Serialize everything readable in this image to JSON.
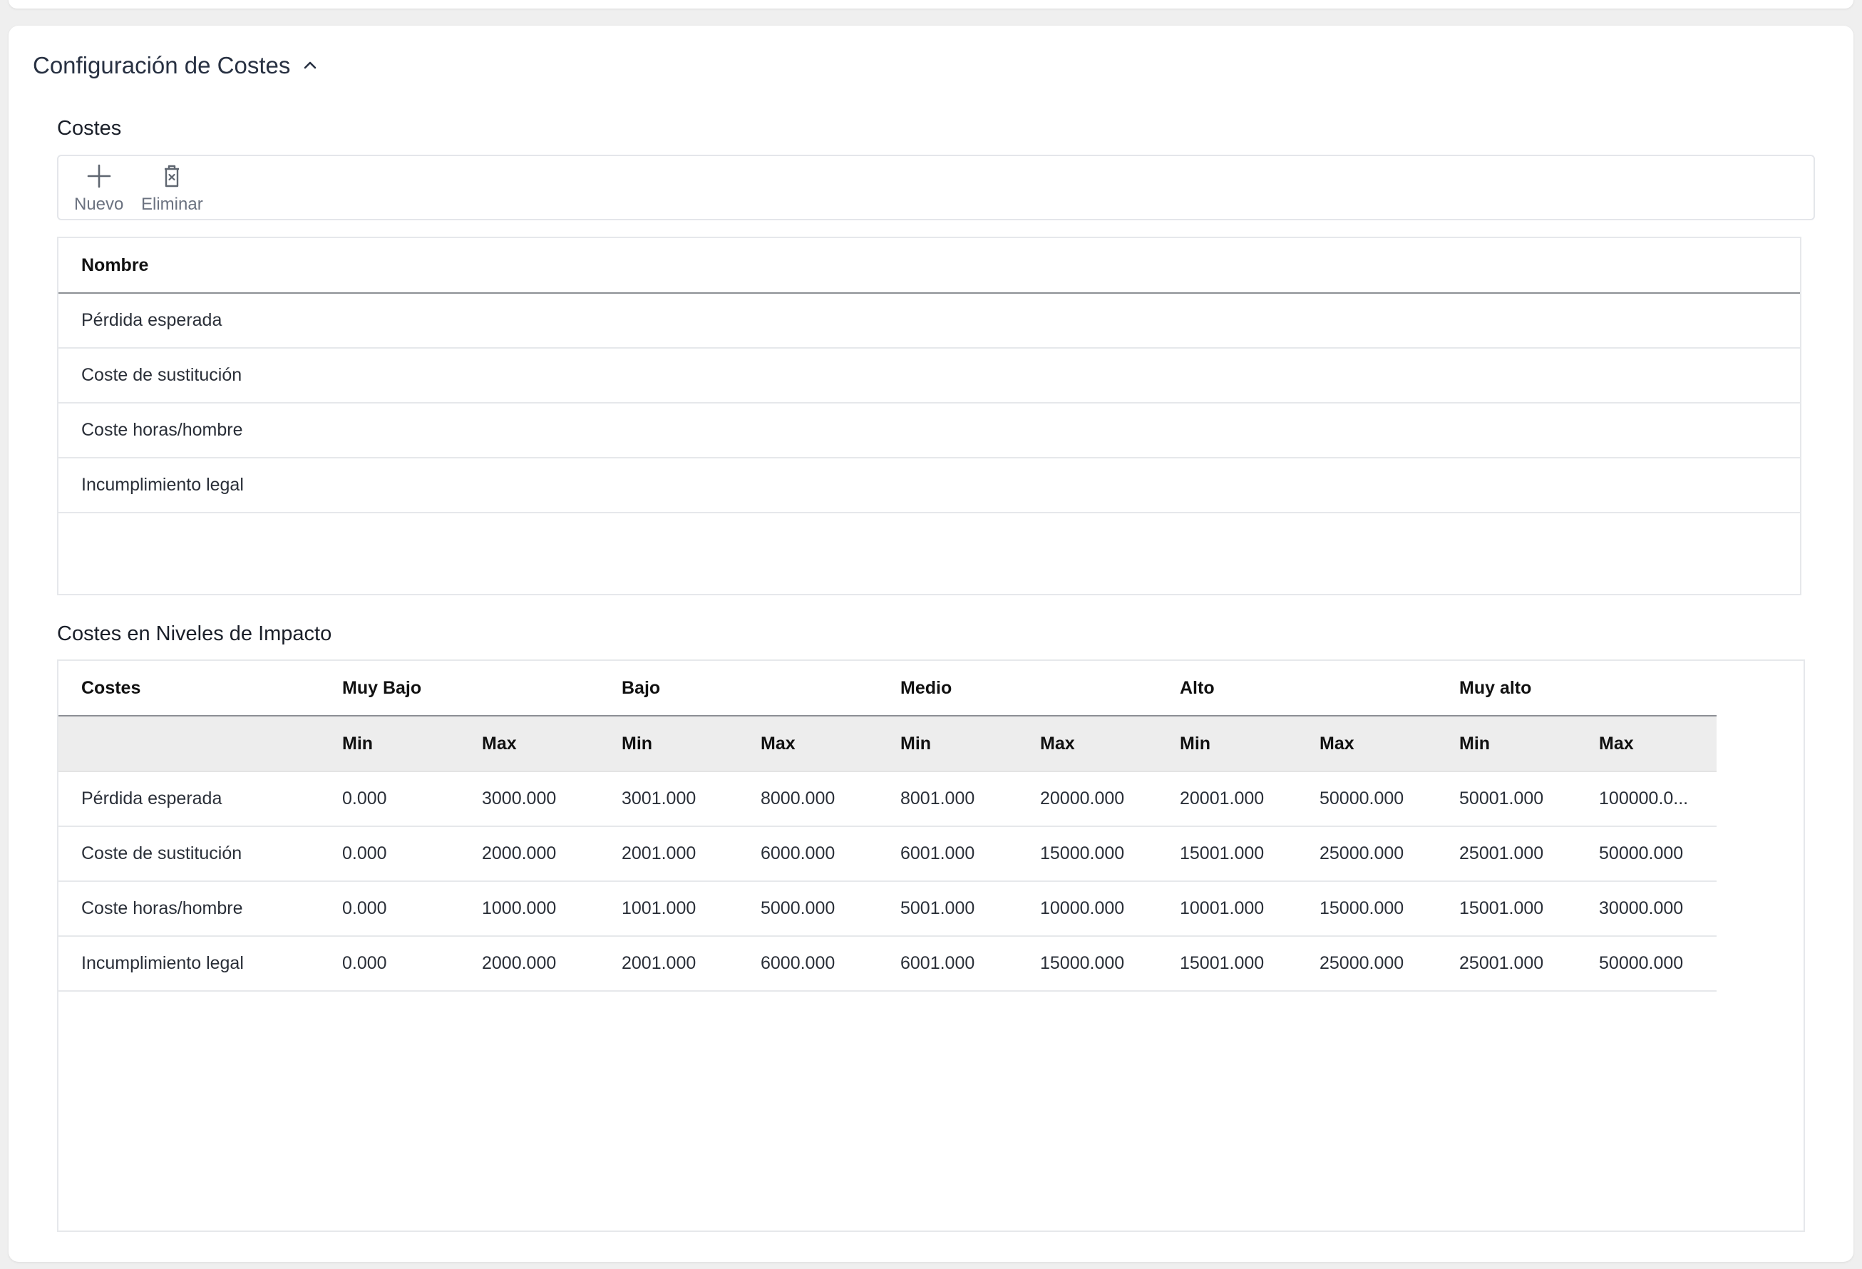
{
  "section": {
    "title": "Configuración de Costes"
  },
  "costes": {
    "title": "Costes",
    "toolbar": {
      "nuevo": "Nuevo",
      "eliminar": "Eliminar"
    },
    "header": "Nombre",
    "rows": [
      "Pérdida esperada",
      "Coste de sustitución",
      "Coste horas/hombre",
      "Incumplimiento legal"
    ]
  },
  "niveles": {
    "title": "Costes en Niveles de Impacto",
    "header_costes": "Costes",
    "levels": [
      "Muy Bajo",
      "Bajo",
      "Medio",
      "Alto",
      "Muy alto"
    ],
    "min": "Min",
    "max": "Max",
    "rows": [
      {
        "name": "Pérdida esperada",
        "values": [
          "0.000",
          "3000.000",
          "3001.000",
          "8000.000",
          "8001.000",
          "20000.000",
          "20001.000",
          "50000.000",
          "50001.000",
          "100000.0..."
        ]
      },
      {
        "name": "Coste de sustitución",
        "values": [
          "0.000",
          "2000.000",
          "2001.000",
          "6000.000",
          "6001.000",
          "15000.000",
          "15001.000",
          "25000.000",
          "25001.000",
          "50000.000"
        ]
      },
      {
        "name": "Coste horas/hombre",
        "values": [
          "0.000",
          "1000.000",
          "1001.000",
          "5000.000",
          "5001.000",
          "10000.000",
          "10001.000",
          "15000.000",
          "15001.000",
          "30000.000"
        ]
      },
      {
        "name": "Incumplimiento legal",
        "values": [
          "0.000",
          "2000.000",
          "2001.000",
          "6000.000",
          "6001.000",
          "15000.000",
          "15001.000",
          "25000.000",
          "25001.000",
          "50000.000"
        ]
      }
    ]
  }
}
